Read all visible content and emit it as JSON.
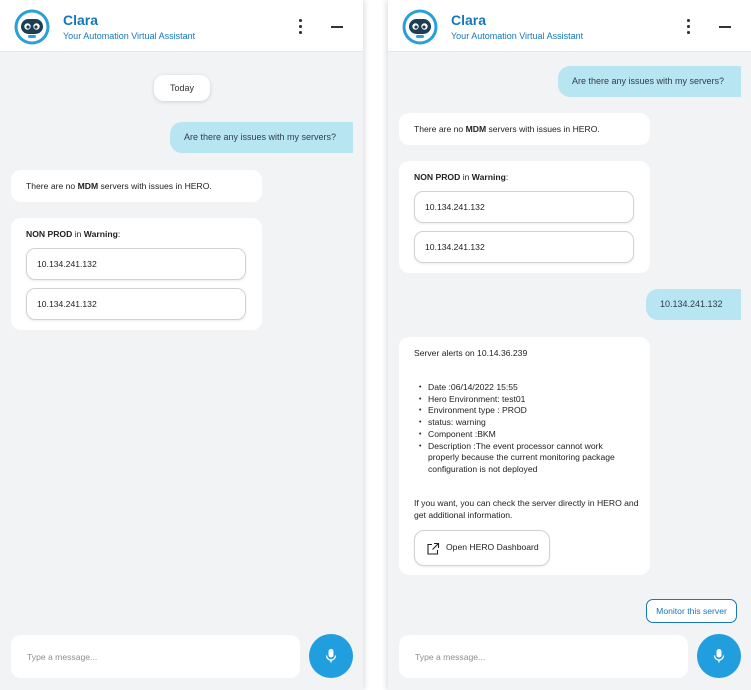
{
  "header": {
    "bot_name": "Clara",
    "bot_subtitle": "Your Automation Virtual Assistant",
    "menu_icon": "more-vertical-icon",
    "minimize_icon": "minimize-icon"
  },
  "colors": {
    "brand": "#1777b8",
    "user_bubble": "#b8e5f2",
    "mic_button": "#219ede",
    "panel_bg": "#f2f3f4"
  },
  "left": {
    "date_chip": "Today",
    "user_message": "Are there any issues with my servers?",
    "reply_pre": "There are no ",
    "reply_bold": "MDM",
    "reply_post": " servers with issues in HERO.",
    "warning_bold1": "NON PROD",
    "warning_mid": " in ",
    "warning_bold2": "Warning",
    "warning_colon": ":",
    "ips": [
      "10.134.241.132",
      "10.134.241.132"
    ]
  },
  "right": {
    "user_message": "Are there any issues with my servers?",
    "reply_pre": "There are no ",
    "reply_bold": "MDM",
    "reply_post": " servers with issues in HERO.",
    "warning_bold1": "NON PROD",
    "warning_mid": " in ",
    "warning_bold2": "Warning",
    "warning_colon": ":",
    "ips": [
      "10.134.241.132",
      "10.134.241.132"
    ],
    "user_ip_message": "10.134.241.132",
    "alert_title": "Server alerts on 10.14.36.239",
    "alert_items": [
      "Date :06/14/2022 15:55",
      "Hero Environment: test01",
      "Environment type : PROD",
      "status: warning",
      "Component :BKM",
      "Description :The event processor cannot work properly because the current monitoring package configuration is not deployed"
    ],
    "alert_footer": "If you want, you can check the server directly in HERO and get additional information.",
    "dashboard_button": "Open HERO Dashboard",
    "monitor_button": "Monitor this server"
  },
  "input": {
    "placeholder": "Type a message..."
  },
  "icons": {
    "logo": "robot-logo-icon",
    "mic": "microphone-icon",
    "external": "external-link-icon"
  }
}
